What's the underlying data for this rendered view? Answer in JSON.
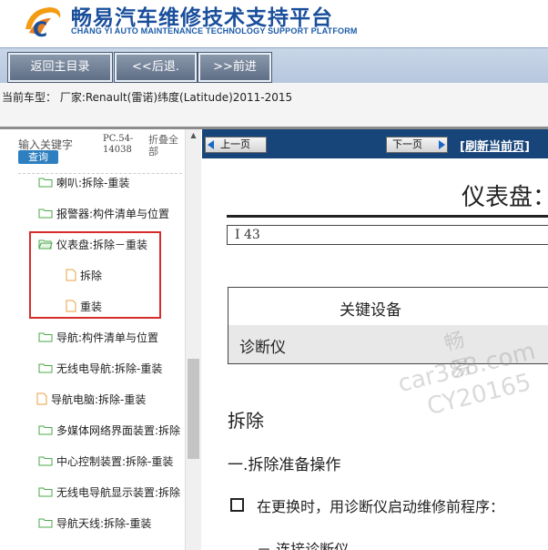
{
  "header": {
    "title": "畅易汽车维修技术支持平台",
    "subtitle": "CHANG YI AUTO MAINTENANCE TECHNOLOGY SUPPORT PLATFORM"
  },
  "nav": {
    "home_label": "返回主目录",
    "back_label": "<<后退.",
    "forward_label": ">>前进"
  },
  "vehicle": {
    "text": "当前车型：  厂家:Renault(雷诺)纬度(Latitude)2011-2015"
  },
  "sidebar": {
    "search_label": "输入关键字",
    "search_button": "查询",
    "pc_label_line1": "PC.54-",
    "pc_label_line2": "14038",
    "collapse_line1": "折叠全",
    "collapse_line2": "部",
    "items": [
      {
        "label": "喇叭:拆除-重装",
        "icon": "folder-icon"
      },
      {
        "label": "报警器:构件清单与位置",
        "icon": "folder-icon"
      },
      {
        "label": "仪表盘:拆除－重装",
        "icon": "folder-open-icon"
      },
      {
        "label": "拆除",
        "icon": "file-icon"
      },
      {
        "label": "重装",
        "icon": "file-icon"
      },
      {
        "label": "导航:构件清单与位置",
        "icon": "folder-icon"
      },
      {
        "label": "无线电导航:拆除-重装",
        "icon": "folder-icon"
      },
      {
        "label": "导航电脑:拆除-重装",
        "icon": "file-icon"
      },
      {
        "label": "多媒体网络界面装置:拆除",
        "icon": "folder-icon"
      },
      {
        "label": "中心控制装置:拆除-重装",
        "icon": "folder-icon"
      },
      {
        "label": "无线电导航显示装置:拆除",
        "icon": "folder-icon"
      },
      {
        "label": "导航天线:拆除-重装",
        "icon": "folder-icon"
      }
    ]
  },
  "content": {
    "prev_label": "上一页",
    "next_label": "下一页",
    "refresh_label": "[刷新当前页]",
    "doc_title": "仪表盘：",
    "code": "I 43",
    "table_header": "关键设备",
    "table_row": "诊断仪",
    "section_removal": "拆除",
    "section_prep": "一.拆除准备操作",
    "step_text": "在更换时，用诊断仪启动维修前程序：",
    "sub_step": "－  连接诊断仪"
  },
  "watermark": {
    "line1": "畅易",
    "line2": "car388.com",
    "line3": "CY20165"
  },
  "colors": {
    "brand_blue": "#1a4f9c",
    "toolbar_navy": "#17457a",
    "highlight_red": "#d62c2c",
    "folder_green": "#4aa84a",
    "file_orange": "#e8a040"
  }
}
